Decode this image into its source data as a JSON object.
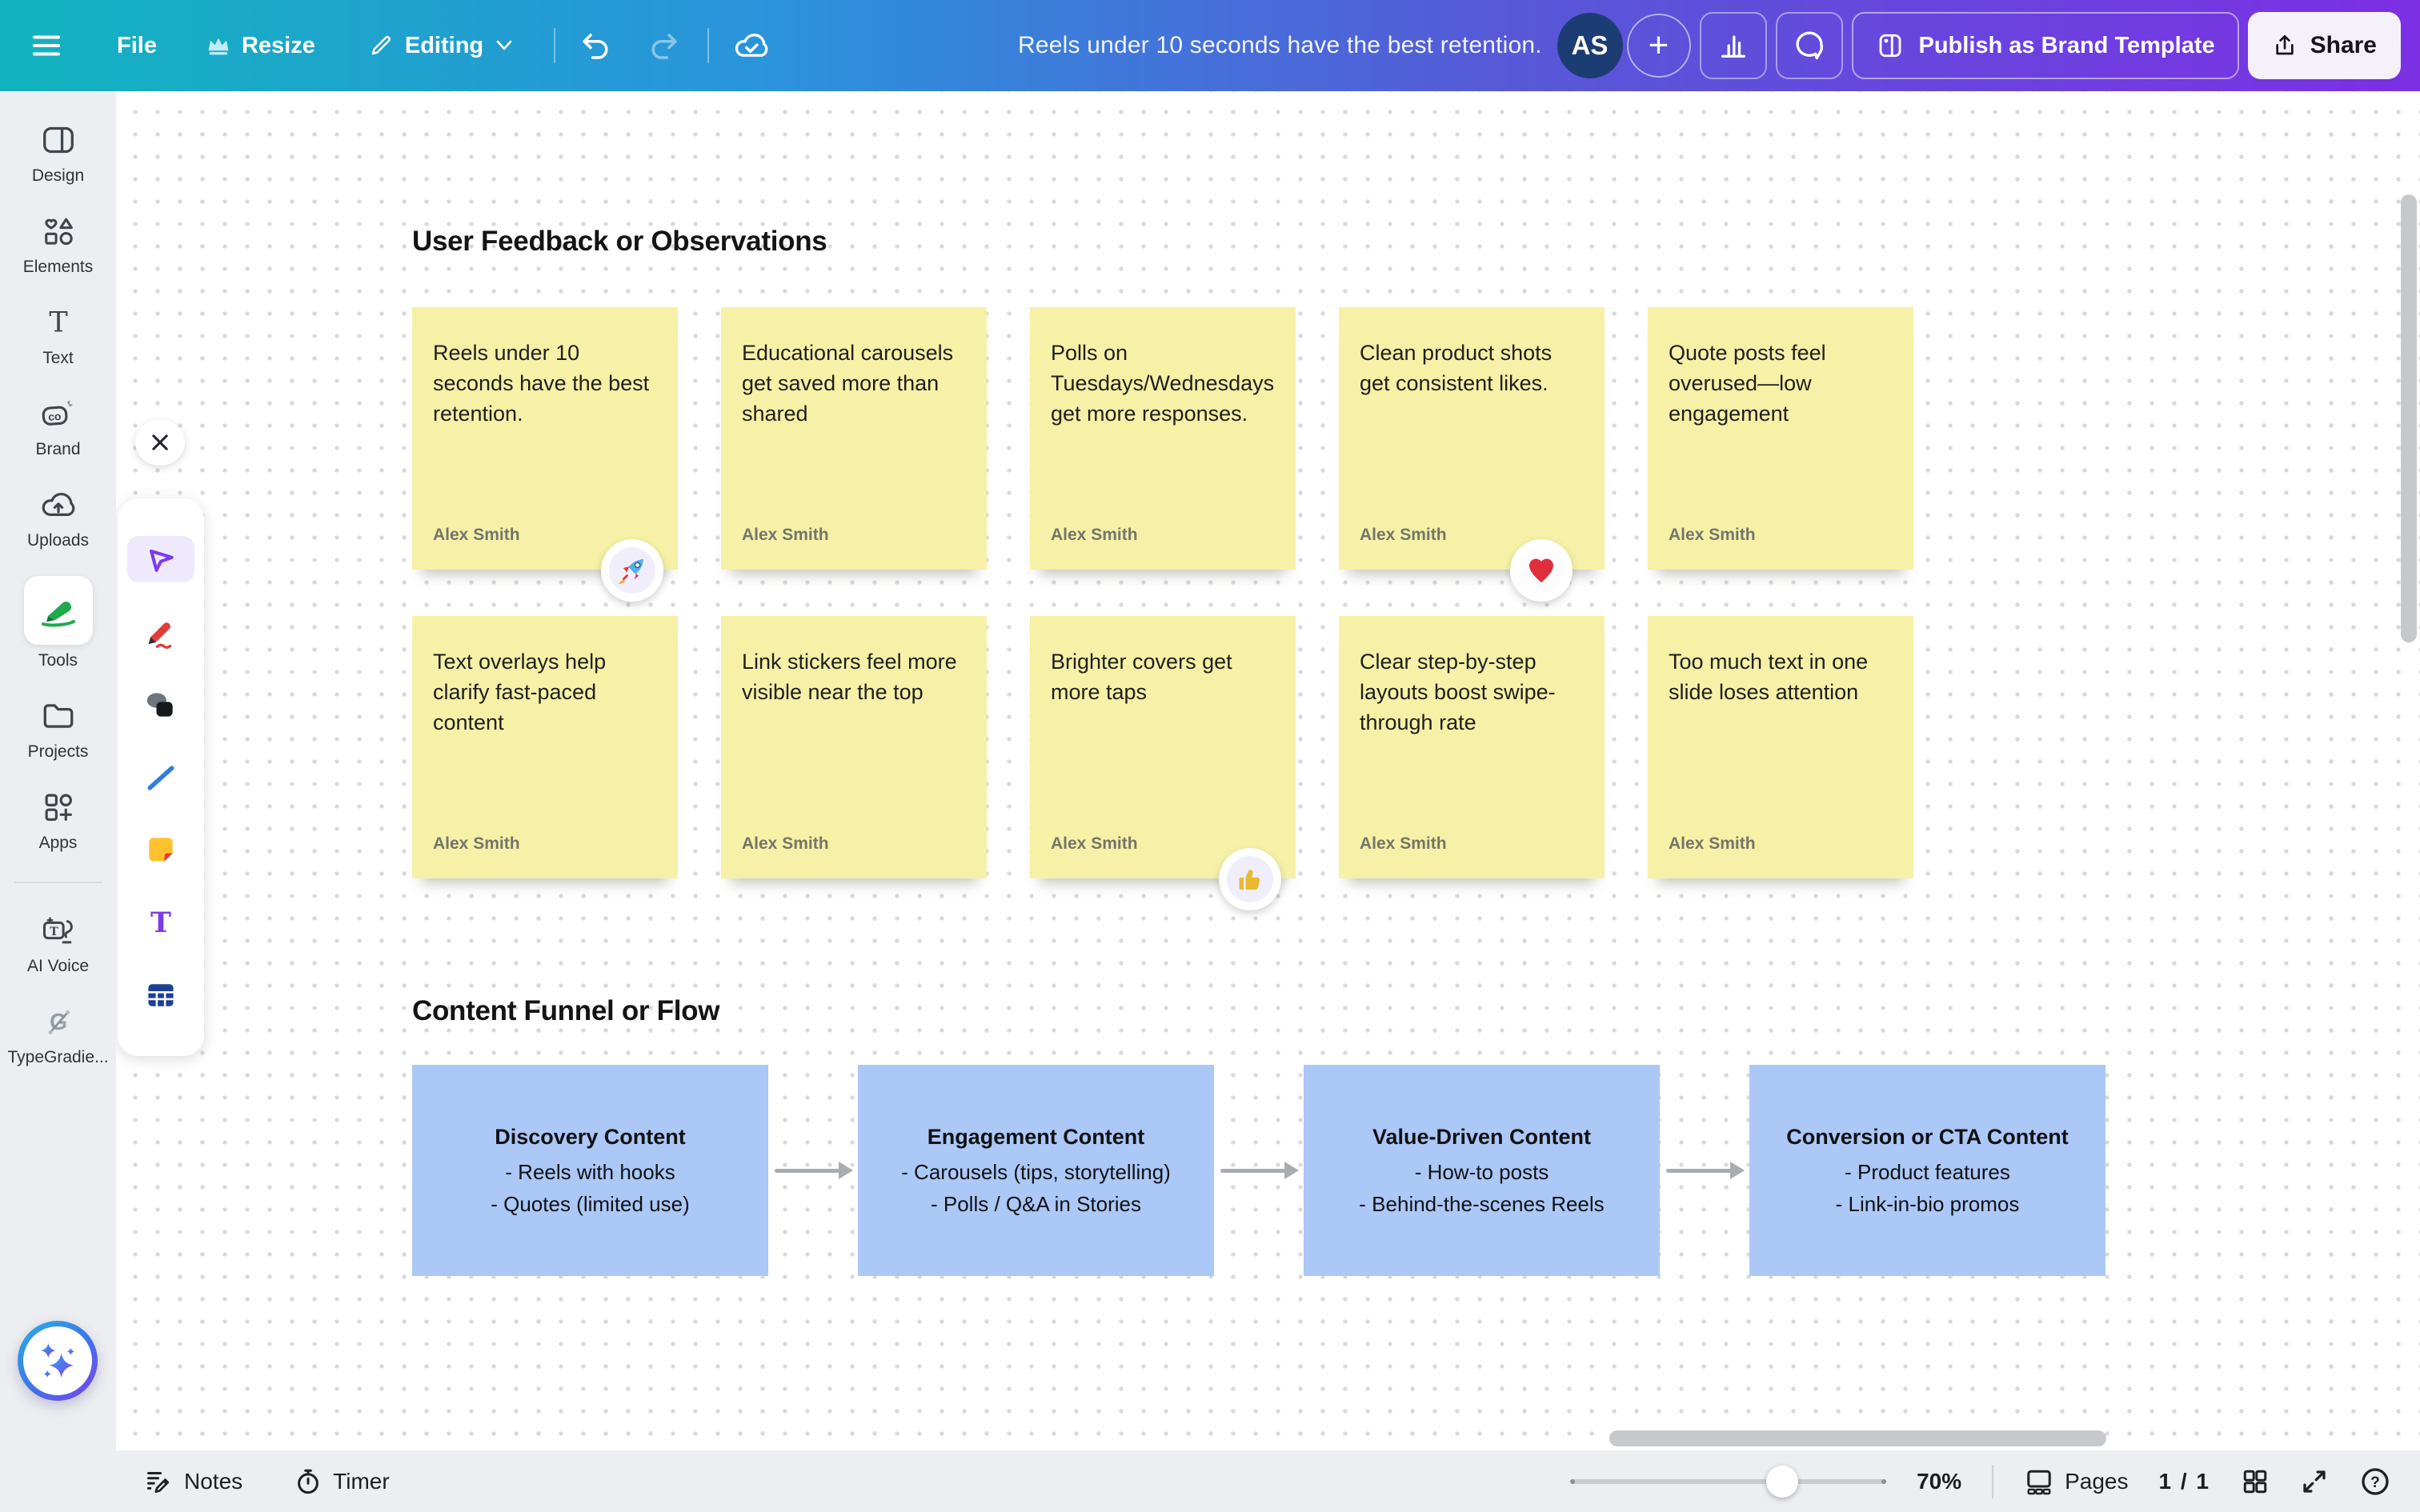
{
  "topbar": {
    "file_label": "File",
    "resize_label": "Resize",
    "editing_label": "Editing",
    "title": "Reels under 10 seconds have the best retention.",
    "avatar_initials": "AS",
    "add_label": "+",
    "publish_label": "Publish as Brand Template",
    "share_label": "Share"
  },
  "sidebar": {
    "items": [
      {
        "label": "Design",
        "icon": "design-icon"
      },
      {
        "label": "Elements",
        "icon": "elements-icon"
      },
      {
        "label": "Text",
        "icon": "text-icon"
      },
      {
        "label": "Brand",
        "icon": "brand-icon"
      },
      {
        "label": "Uploads",
        "icon": "uploads-icon"
      },
      {
        "label": "Tools",
        "icon": "tools-icon",
        "active": true
      },
      {
        "label": "Projects",
        "icon": "projects-icon"
      },
      {
        "label": "Apps",
        "icon": "apps-icon"
      },
      {
        "label": "AI Voice",
        "icon": "ai-voice-icon"
      },
      {
        "label": "TypeGradie...",
        "icon": "typegradient-icon"
      }
    ]
  },
  "tool_panel": {
    "tools": [
      "select",
      "draw-marker",
      "shapes",
      "line",
      "sticky-note",
      "text",
      "table"
    ],
    "active_tool": "select"
  },
  "canvas": {
    "sections": [
      {
        "title": "User Feedback or Observations",
        "notes": [
          {
            "text": "Reels under 10 seconds have the best retention.",
            "author": "Alex Smith",
            "reaction": "rocket"
          },
          {
            "text": "Educational carousels get saved more than shared",
            "author": "Alex Smith",
            "reaction": null
          },
          {
            "text": "Polls on Tuesdays/Wednesdays get more responses.",
            "author": "Alex Smith",
            "reaction": null
          },
          {
            "text": "Clean product shots get consistent likes.",
            "author": "Alex Smith",
            "reaction": "heart"
          },
          {
            "text": "Quote posts feel overused—low engagement",
            "author": "Alex Smith",
            "reaction": null
          },
          {
            "text": "Text overlays help clarify fast-paced content",
            "author": "Alex Smith",
            "reaction": null
          },
          {
            "text": "Link stickers feel more visible near the top",
            "author": "Alex Smith",
            "reaction": null
          },
          {
            "text": "Brighter covers get more taps",
            "author": "Alex Smith",
            "reaction": "thumbs-up"
          },
          {
            "text": "Clear step-by-step layouts boost swipe-through rate",
            "author": "Alex Smith",
            "reaction": null
          },
          {
            "text": "Too much text in one slide loses attention",
            "author": "Alex Smith",
            "reaction": null
          }
        ]
      },
      {
        "title": "Content Funnel or Flow",
        "boxes": [
          {
            "title": "Discovery Content",
            "items": [
              "- Reels with hooks",
              "- Quotes (limited use)"
            ]
          },
          {
            "title": "Engagement Content",
            "items": [
              "- Carousels (tips, storytelling)",
              "- Polls / Q&A in Stories"
            ]
          },
          {
            "title": "Value-Driven Content",
            "items": [
              "- How-to posts",
              "- Behind-the-scenes Reels"
            ]
          },
          {
            "title": "Conversion or CTA Content",
            "items": [
              "- Product features",
              "- Link-in-bio promos"
            ]
          }
        ]
      }
    ]
  },
  "bottombar": {
    "notes_label": "Notes",
    "timer_label": "Timer",
    "zoom_level": "70%",
    "pages_label": "Pages",
    "page_indicator": "1 / 1"
  },
  "colors": {
    "sticky_note": "#f6f1a7",
    "flow_box": "#abc8f7",
    "topbar_gradient": [
      "#12b3bf",
      "#2b93dc",
      "#5659d8",
      "#7c2fe3"
    ],
    "accent_purple": "#7c3aed",
    "tools_green": "#21a94d"
  }
}
